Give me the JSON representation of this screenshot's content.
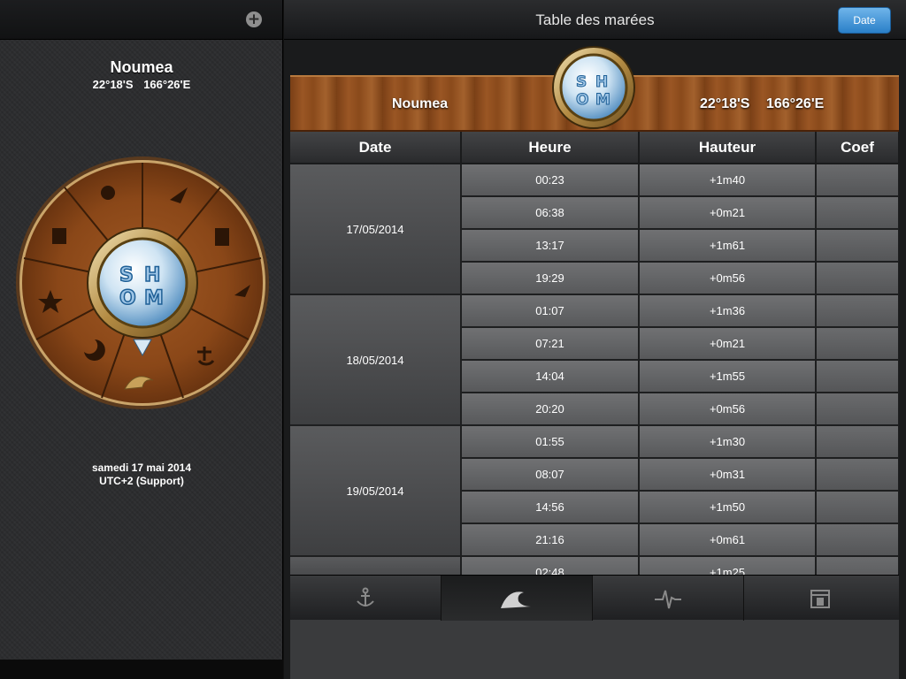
{
  "left": {
    "city": "Noumea",
    "lat": "22°18'S",
    "lon": "166°26'E",
    "date": "samedi 17 mai 2014",
    "timezone": "UTC+2 (Support)",
    "logo_letters": [
      "S",
      "H",
      "O",
      "M"
    ]
  },
  "header": {
    "title": "Table des marées",
    "date_button": "Date"
  },
  "banner": {
    "city": "Noumea",
    "lat": "22°18'S",
    "lon": "166°26'E"
  },
  "table": {
    "columns": [
      "Date",
      "Heure",
      "Hauteur",
      "Coef"
    ],
    "days": [
      {
        "date": "17/05/2014",
        "rows": [
          [
            "00:23",
            "+1m40",
            ""
          ],
          [
            "06:38",
            "+0m21",
            ""
          ],
          [
            "13:17",
            "+1m61",
            ""
          ],
          [
            "19:29",
            "+0m56",
            ""
          ]
        ]
      },
      {
        "date": "18/05/2014",
        "rows": [
          [
            "01:07",
            "+1m36",
            ""
          ],
          [
            "07:21",
            "+0m21",
            ""
          ],
          [
            "14:04",
            "+1m55",
            ""
          ],
          [
            "20:20",
            "+0m56",
            ""
          ]
        ]
      },
      {
        "date": "19/05/2014",
        "rows": [
          [
            "01:55",
            "+1m30",
            ""
          ],
          [
            "08:07",
            "+0m31",
            ""
          ],
          [
            "14:56",
            "+1m50",
            ""
          ],
          [
            "21:16",
            "+0m61",
            ""
          ]
        ]
      }
    ],
    "partial_row": {
      "time": "02:48",
      "height": "+1m25"
    }
  },
  "tabs": [
    "anchor-icon",
    "wave-icon",
    "pulse-icon",
    "calendar-icon"
  ],
  "accent": "#2a7fc8"
}
